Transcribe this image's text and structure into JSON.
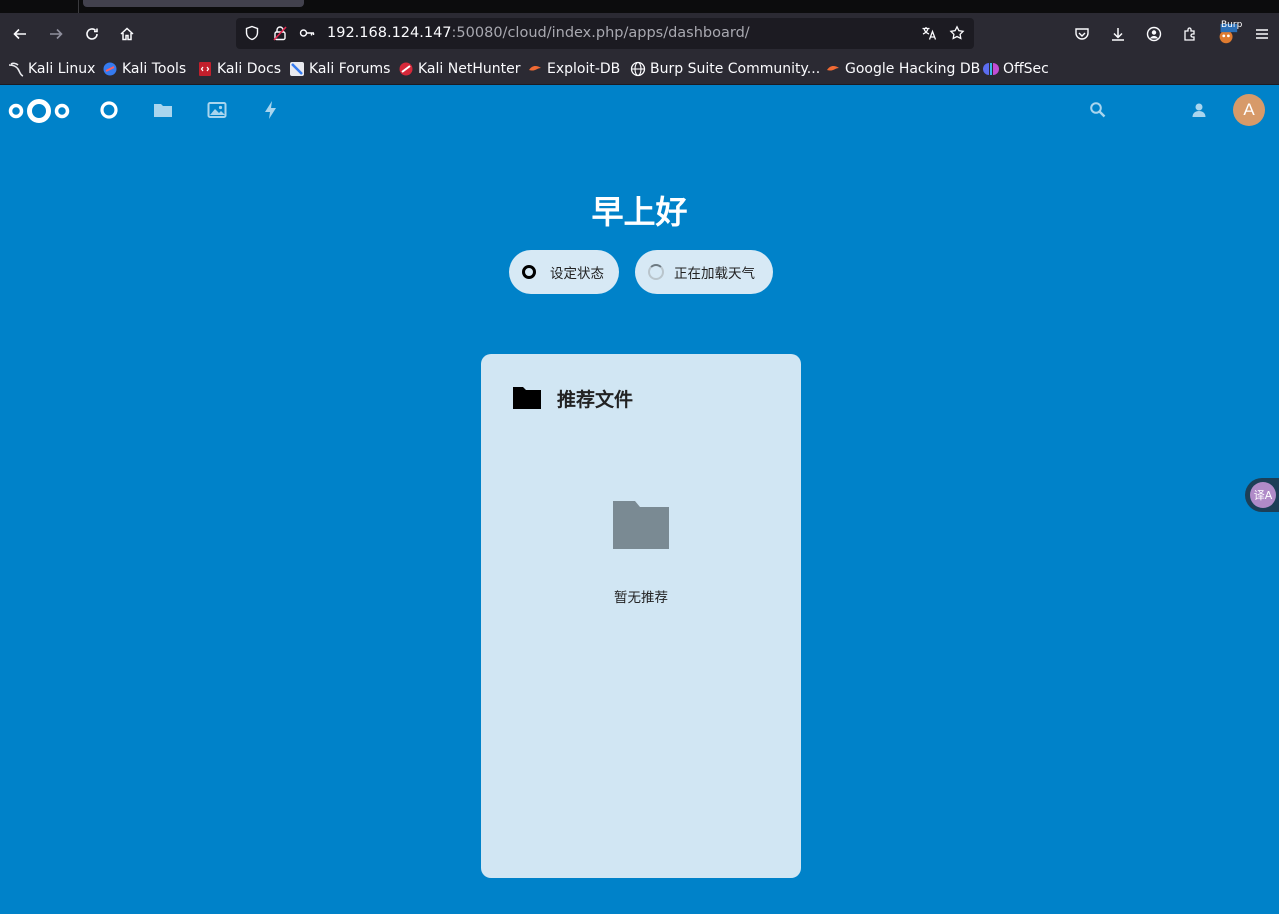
{
  "browser": {
    "url_host": "192.168.124.147",
    "url_rest": ":50080/cloud/index.php/apps/dashboard/",
    "bookmarks": [
      {
        "label": "Kali Linux"
      },
      {
        "label": "Kali Tools"
      },
      {
        "label": "Kali Docs"
      },
      {
        "label": "Kali Forums"
      },
      {
        "label": "Kali NetHunter"
      },
      {
        "label": "Exploit-DB"
      },
      {
        "label": "Burp Suite Community..."
      },
      {
        "label": "Google Hacking DB"
      },
      {
        "label": "OffSec"
      }
    ],
    "burp_badge": "Burp"
  },
  "header": {
    "apps": [
      {
        "name": "dashboard-icon"
      },
      {
        "name": "files-icon"
      },
      {
        "name": "photos-icon"
      },
      {
        "name": "activity-icon"
      }
    ],
    "avatar_letter": "A"
  },
  "dashboard": {
    "greeting": "早上好",
    "status_label": "设定状态",
    "weather_label": "正在加载天气"
  },
  "widget": {
    "title": "推荐文件",
    "empty_text": "暂无推荐"
  },
  "side_widget": {
    "label": "译A"
  },
  "colors": {
    "nc_blue": "#0082c9",
    "panel_bg": "#d1e6f3",
    "avatar": "#d79a69"
  }
}
